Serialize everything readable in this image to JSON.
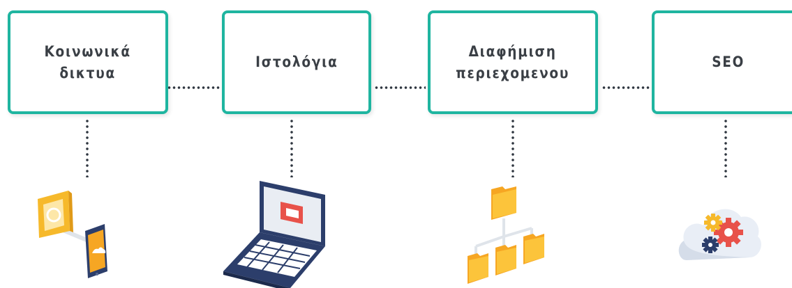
{
  "steps": [
    {
      "label": "Κοινωνικά\nδικτυα",
      "icon": "social-media-icon"
    },
    {
      "label": "Ιστολόγια",
      "icon": "laptop-blog-icon"
    },
    {
      "label": "Διαφήμιση\nπεριεχομενου",
      "icon": "folder-hierarchy-icon"
    },
    {
      "label": "SEO",
      "icon": "cloud-gears-icon"
    }
  ],
  "colors": {
    "accent": "#1fb5a0",
    "text": "#3a3f45",
    "dots": "#2f3640",
    "folder": "#f6b92b",
    "red": "#e8524a",
    "device_dark": "#2c3e6b"
  }
}
